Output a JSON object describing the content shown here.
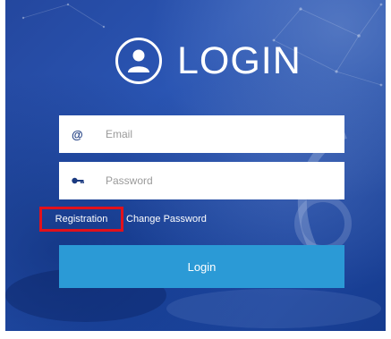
{
  "header": {
    "title": "LOGIN",
    "icon": "user-avatar-icon"
  },
  "form": {
    "email_placeholder": "Email",
    "email_icon": "at-sign-icon",
    "password_placeholder": "Password",
    "password_icon": "key-icon"
  },
  "links": {
    "registration": "Registration",
    "change_password": "Change Password",
    "registration_highlight_color": "#e2111b"
  },
  "actions": {
    "login_label": "Login",
    "login_color": "#2b9ad6"
  }
}
